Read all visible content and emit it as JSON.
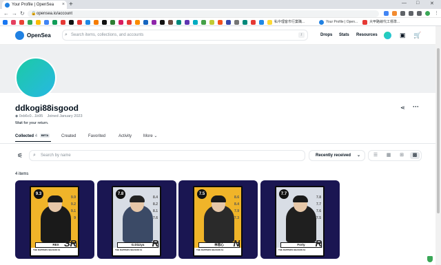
{
  "browser": {
    "tab_title": "Your Profile | OpenSea",
    "tab_close": "×",
    "new_tab": "+",
    "win_minimize": "—",
    "win_maximize": "□",
    "win_close": "✕",
    "url": "opensea.io/account",
    "bookmark_1": "私中理客市行業職...",
    "bookmark_2": "Your Profile | Open...",
    "bookmark_3": "大甲路線代工標準...",
    "colors": {
      "tabbar": "#dee1e6",
      "accent": "#1a73e8"
    }
  },
  "header": {
    "logo_text": "OpenSea",
    "search_placeholder": "Search items, collections, and accounts",
    "search_shortcut": "/",
    "nav": [
      "Drops",
      "Stats",
      "Resources"
    ],
    "icons": [
      "wallet-icon",
      "cart-icon"
    ]
  },
  "profile": {
    "username": "ddkogi88isgood",
    "address": "0xb6c0...1b95",
    "joined": "Joined January 2023",
    "bio": "Wait for your return.",
    "share_icon": "share-icon",
    "more_icon": "more-icon"
  },
  "tabs": {
    "collected": "Collected",
    "collected_count": "4",
    "collected_badge": "BETA",
    "created": "Created",
    "favorited": "Favorited",
    "activity": "Activity",
    "more": "More"
  },
  "toolbar": {
    "filter_icon": "filter-icon",
    "search_placeholder": "Search by name",
    "sort_label": "Recently received",
    "view_modes": [
      "list-view-icon",
      "large-grid-icon",
      "grid-icon",
      "compact-grid-icon"
    ]
  },
  "items": {
    "count_label": "4 items",
    "cards": [
      {
        "score": "9.3",
        "name": "REX",
        "rank": "SR",
        "stats": [
          "9.9",
          "9.2",
          "9.1",
          "9"
        ],
        "footer": "THE RAPPERS SEASON S1",
        "bg": "#f0b429"
      },
      {
        "score": "7.8",
        "name": "G.Dizzya",
        "rank": "R",
        "stats": [
          "8.4",
          "8.2",
          "8.1",
          "7.6"
        ],
        "footer": "THE RAPPERS SEASON S1",
        "bg": "#d8dde5"
      },
      {
        "score": "7.5",
        "name": "林思心",
        "rank": "N",
        "stats": [
          "8.6",
          "8.4",
          "7.9",
          "7.3"
        ],
        "footer": "THE RAPPERS SEASON S1",
        "bg": "#f0b429"
      },
      {
        "score": "7.7",
        "name": "Forty",
        "rank": "R",
        "stats": [
          "7.8",
          "7.7",
          "7.6",
          "7.5"
        ],
        "footer": "THE RAPPERS SEASON S1",
        "bg": "#d8dde5"
      }
    ]
  },
  "colors": {
    "brand": "#2081e2",
    "card_bg": "#1a1652",
    "text": "#04111d",
    "muted": "#707a83"
  }
}
